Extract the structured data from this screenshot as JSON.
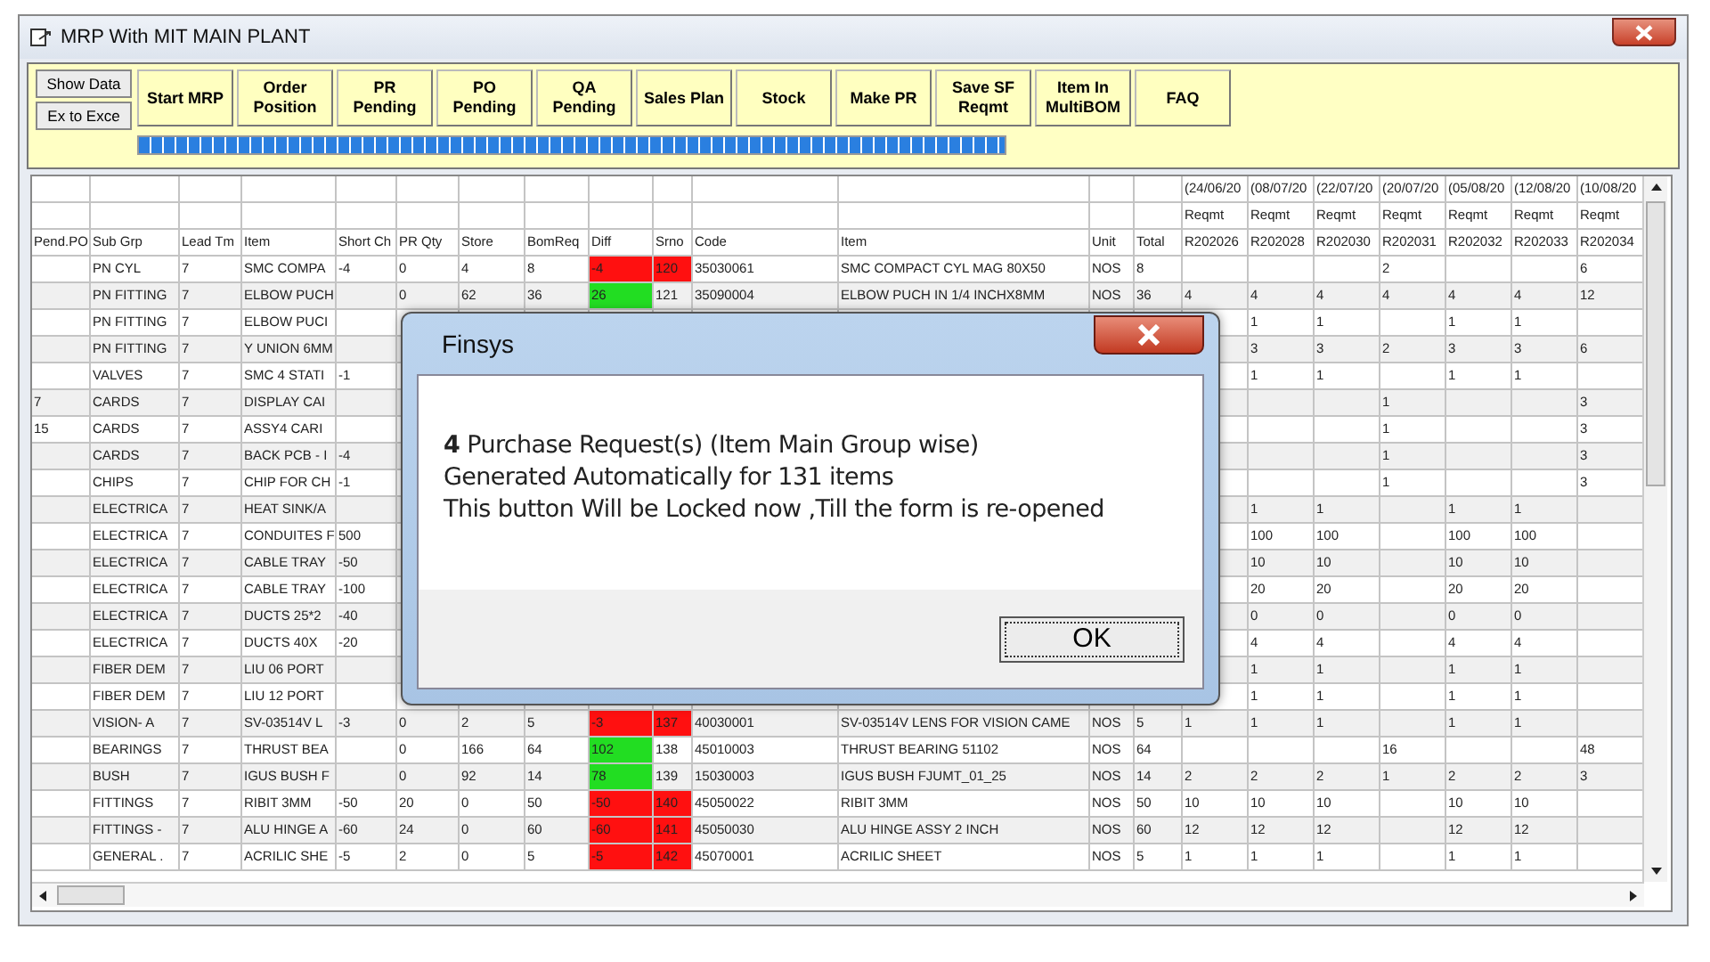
{
  "window": {
    "title": "MRP With MIT MAIN PLANT"
  },
  "side_buttons": [
    "Show Data",
    "Ex to Exce"
  ],
  "toolbar": [
    "Start MRP",
    "Order Position",
    "PR Pending",
    "PO Pending",
    "QA Pending",
    "Sales Plan",
    "Stock",
    "Make PR",
    "Save SF Reqmt",
    "Item In MultiBOM",
    "FAQ"
  ],
  "progress": {
    "level": 1
  },
  "table": {
    "date_headers": [
      "(24/06/20",
      "(08/07/20",
      "(22/07/20",
      "(20/07/20",
      "(05/08/20",
      "(12/08/20",
      "(10/08/20"
    ],
    "reqmt_headers": [
      "Reqmt",
      "Reqmt",
      "Reqmt",
      "Reqmt",
      "Reqmt",
      "Reqmt",
      "Reqmt"
    ],
    "columns": [
      "Pend.PO",
      "Sub Grp",
      "Lead Tm",
      "Item",
      "Short Ch",
      "PR Qty",
      "Store",
      "BomReq",
      "Diff",
      "Srno",
      "Code",
      "Item",
      "Unit",
      "Total",
      "R202026",
      "R202028",
      "R202030",
      "R202031",
      "R202032",
      "R202033",
      "R202034"
    ],
    "rows": [
      {
        "color": "#ff1010",
        "srno_highlighted": true,
        "cells": [
          null,
          "PN CYL",
          "7",
          "SMC COMPA",
          "-4",
          "0",
          "4",
          "8",
          "-4",
          "120",
          "35030061",
          "SMC COMPACT CYL MAG 80X50",
          "NOS",
          "8",
          null,
          null,
          null,
          "2",
          null,
          null,
          "6"
        ]
      },
      {
        "color": "#22dd22",
        "srno_highlighted": false,
        "cells": [
          null,
          "PN FITTING",
          "7",
          "ELBOW PUCH",
          null,
          "0",
          "62",
          "36",
          "26",
          "121",
          "35090004",
          "ELBOW PUCH IN 1/4 INCHX8MM",
          "NOS",
          "36",
          "4",
          "4",
          "4",
          "4",
          "4",
          "4",
          "12"
        ]
      },
      {
        "cells": [
          null,
          "PN FITTING",
          "7",
          "ELBOW PUCI",
          null,
          null,
          null,
          null,
          null,
          null,
          null,
          null,
          null,
          null,
          null,
          "1",
          "1",
          null,
          "1",
          "1",
          null
        ]
      },
      {
        "cells": [
          null,
          "PN FITTING",
          "7",
          "Y UNION 6MM",
          null,
          null,
          null,
          null,
          null,
          null,
          null,
          null,
          null,
          null,
          null,
          "3",
          "3",
          "2",
          "3",
          "3",
          "6"
        ]
      },
      {
        "cells": [
          null,
          "VALVES",
          "7",
          "SMC 4 STATI",
          "-1",
          null,
          null,
          null,
          null,
          null,
          null,
          null,
          null,
          null,
          null,
          "1",
          "1",
          null,
          "1",
          "1",
          null
        ]
      },
      {
        "cells": [
          "7",
          "CARDS",
          "7",
          "DISPLAY CAI",
          null,
          null,
          null,
          null,
          null,
          null,
          null,
          null,
          null,
          null,
          null,
          null,
          null,
          "1",
          null,
          null,
          "3"
        ]
      },
      {
        "cells": [
          "15",
          "CARDS",
          "7",
          "ASSY4 CARI",
          null,
          null,
          null,
          null,
          null,
          null,
          null,
          null,
          null,
          null,
          null,
          null,
          null,
          "1",
          null,
          null,
          "3"
        ]
      },
      {
        "cells": [
          null,
          "CARDS",
          "7",
          "BACK PCB - I",
          "-4",
          null,
          null,
          null,
          null,
          null,
          null,
          null,
          null,
          null,
          null,
          null,
          null,
          "1",
          null,
          null,
          "3"
        ]
      },
      {
        "cells": [
          null,
          "CHIPS",
          "7",
          "CHIP FOR CH",
          "-1",
          null,
          null,
          null,
          null,
          null,
          null,
          null,
          null,
          null,
          null,
          null,
          null,
          "1",
          null,
          null,
          "3"
        ]
      },
      {
        "cells": [
          null,
          "ELECTRICA",
          "7",
          "HEAT SINK/A",
          null,
          null,
          null,
          null,
          null,
          null,
          null,
          null,
          null,
          null,
          null,
          "1",
          "1",
          null,
          "1",
          "1",
          null
        ]
      },
      {
        "cells": [
          null,
          "ELECTRICA",
          "7",
          "CONDUITES F",
          "500",
          null,
          null,
          null,
          null,
          null,
          null,
          null,
          null,
          null,
          null,
          "100",
          "100",
          null,
          "100",
          "100",
          null
        ]
      },
      {
        "cells": [
          null,
          "ELECTRICA",
          "7",
          "CABLE TRAY",
          "-50",
          null,
          null,
          null,
          null,
          null,
          null,
          null,
          null,
          null,
          null,
          "10",
          "10",
          null,
          "10",
          "10",
          null
        ]
      },
      {
        "cells": [
          null,
          "ELECTRICA",
          "7",
          "CABLE TRAY",
          "-100",
          null,
          null,
          null,
          null,
          null,
          null,
          null,
          null,
          null,
          null,
          "20",
          "20",
          null,
          "20",
          "20",
          null
        ]
      },
      {
        "cells": [
          null,
          "ELECTRICA",
          "7",
          "DUCTS 25*2",
          "-40",
          null,
          null,
          null,
          null,
          null,
          null,
          null,
          null,
          null,
          null,
          "0",
          "0",
          null,
          "0",
          "0",
          null
        ]
      },
      {
        "cells": [
          null,
          "ELECTRICA",
          "7",
          "DUCTS 40X",
          "-20",
          null,
          null,
          null,
          null,
          null,
          null,
          null,
          null,
          null,
          null,
          "4",
          "4",
          null,
          "4",
          "4",
          null
        ]
      },
      {
        "cells": [
          null,
          "FIBER DEM",
          "7",
          "LIU 06 PORT",
          null,
          null,
          null,
          null,
          null,
          null,
          null,
          null,
          null,
          null,
          null,
          "1",
          "1",
          null,
          "1",
          "1",
          null
        ]
      },
      {
        "cells": [
          null,
          "FIBER DEM",
          "7",
          "LIU 12 PORT",
          null,
          null,
          null,
          null,
          null,
          null,
          null,
          null,
          null,
          null,
          null,
          "1",
          "1",
          null,
          "1",
          "1",
          null
        ]
      },
      {
        "color": "#ff1010",
        "srno_highlighted": true,
        "cells": [
          null,
          "VISION- A",
          "7",
          "SV-03514V L",
          "-3",
          "0",
          "2",
          "5",
          "-3",
          "137",
          "40030001",
          "SV-03514V LENS FOR VISION CAME",
          "NOS",
          "5",
          "1",
          "1",
          "1",
          null,
          "1",
          "1",
          null
        ]
      },
      {
        "color": "#22dd22",
        "srno_highlighted": false,
        "cells": [
          null,
          "BEARINGS",
          "7",
          "THRUST BEA",
          null,
          "0",
          "166",
          "64",
          "102",
          "138",
          "45010003",
          "THRUST BEARING 51102",
          "NOS",
          "64",
          null,
          null,
          null,
          "16",
          null,
          null,
          "48"
        ]
      },
      {
        "color": "#22dd22",
        "srno_highlighted": false,
        "cells": [
          null,
          "BUSH",
          "7",
          "IGUS BUSH F",
          null,
          "0",
          "92",
          "14",
          "78",
          "139",
          "15030003",
          "IGUS BUSH FJUMT_01_25",
          "NOS",
          "14",
          "2",
          "2",
          "2",
          "1",
          "2",
          "2",
          "3"
        ]
      },
      {
        "color": "#ff1010",
        "srno_highlighted": true,
        "cells": [
          null,
          "FITTINGS",
          "7",
          "RIBIT 3MM",
          "-50",
          "20",
          "0",
          "50",
          "-50",
          "140",
          "45050022",
          "RIBIT 3MM",
          "NOS",
          "50",
          "10",
          "10",
          "10",
          null,
          "10",
          "10",
          null
        ]
      },
      {
        "color": "#ff1010",
        "srno_highlighted": true,
        "cells": [
          null,
          "FITTINGS -",
          "7",
          "ALU HINGE A",
          "-60",
          "24",
          "0",
          "60",
          "-60",
          "141",
          "45050030",
          "ALU HINGE ASSY 2 INCH",
          "NOS",
          "60",
          "12",
          "12",
          "12",
          null,
          "12",
          "12",
          null
        ]
      },
      {
        "color": "#ff1010",
        "srno_highlighted": true,
        "cells": [
          null,
          "GENERAL .",
          "7",
          "ACRILIC SHE",
          "-5",
          "2",
          "0",
          "5",
          "-5",
          "142",
          "45070001",
          "ACRILIC SHEET",
          "NOS",
          "5",
          "1",
          "1",
          "1",
          null,
          "1",
          "1",
          null
        ]
      }
    ]
  },
  "dialog": {
    "title": "Finsys",
    "lines": [
      "**4** Purchase Request(s) (Item Main Group wise)",
      "Generated Automatically  for 131 items",
      "This button Will be Locked now ,Till the form is re-opened"
    ],
    "button": "OK"
  }
}
